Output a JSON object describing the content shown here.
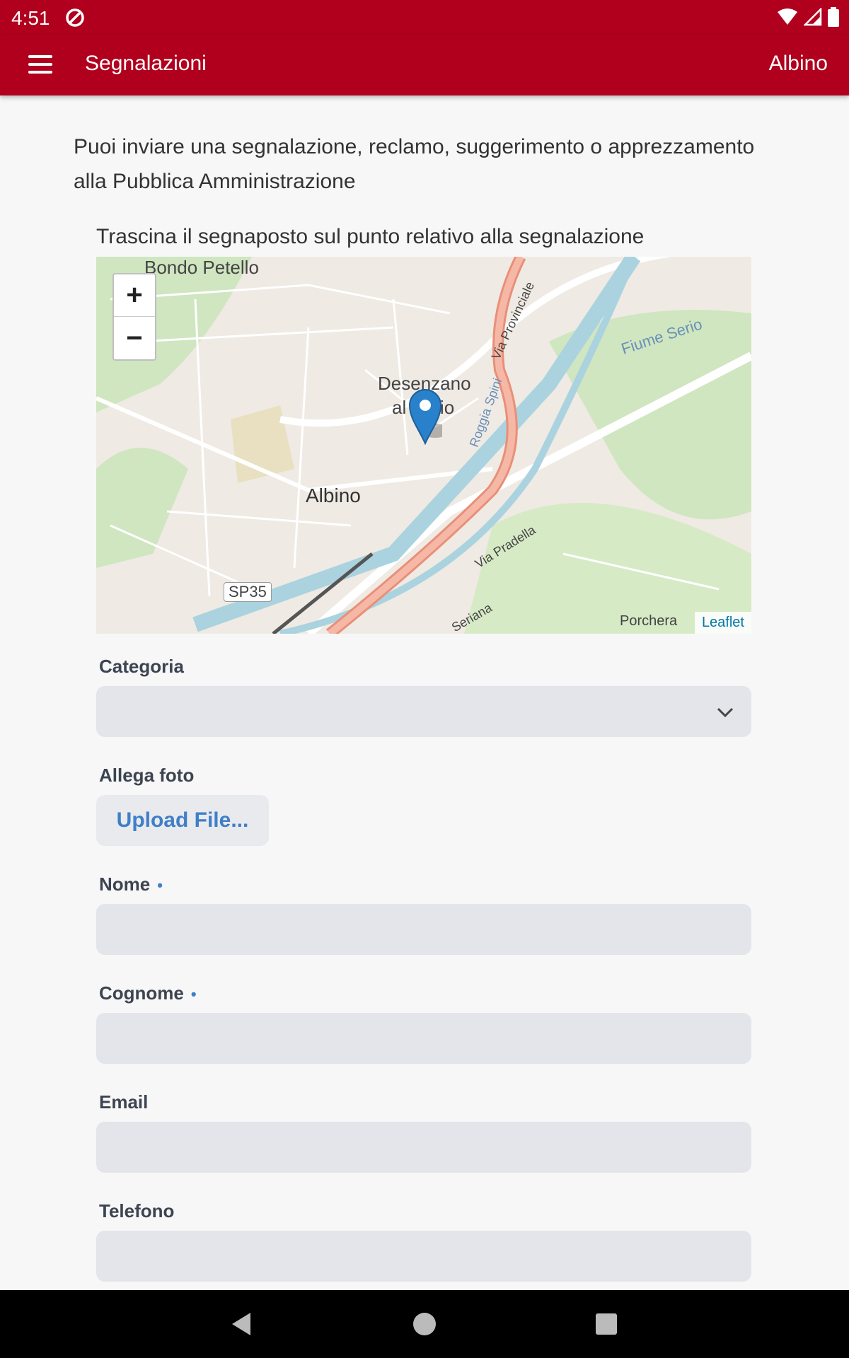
{
  "status_bar": {
    "time": "4:51",
    "icons": [
      "sync-off-icon",
      "wifi-icon",
      "signal-icon",
      "battery-icon"
    ]
  },
  "app_bar": {
    "title": "Segnalazioni",
    "location": "Albino",
    "menu_icon": "hamburger-menu-icon"
  },
  "intro_text": "Puoi inviare una segnalazione, reclamo, suggerimento o apprezzamento alla Pubblica Amministrazione",
  "map": {
    "instruction": "Trascina il segnaposto sul punto relativo alla segnalazione",
    "zoom_in": "+",
    "zoom_out": "−",
    "attribution": "Leaflet",
    "labels": {
      "bondo_petello": "Bondo Petello",
      "desenzano_1": "Desenzano",
      "desenzano_2": "al Serio",
      "albino": "Albino",
      "sp35": "SP35",
      "porchera": "Porchera",
      "via_pradella": "Via Pradella",
      "via_provinciale": "Via Provinciale",
      "fiume_serio": "Fiume Serio",
      "roggia_spini": "Roggia Spini",
      "seriana": "Seriana"
    }
  },
  "form": {
    "categoria": {
      "label": "Categoria",
      "value": ""
    },
    "allega_foto": {
      "label": "Allega foto",
      "button": "Upload File..."
    },
    "nome": {
      "label": "Nome",
      "required_mark": "•",
      "value": ""
    },
    "cognome": {
      "label": "Cognome",
      "required_mark": "•",
      "value": ""
    },
    "email": {
      "label": "Email",
      "value": ""
    },
    "telefono": {
      "label": "Telefono",
      "value": ""
    }
  },
  "colors": {
    "brand": "#b0001e",
    "accent": "#3f7fc7",
    "field_bg": "#e3e5ea"
  }
}
